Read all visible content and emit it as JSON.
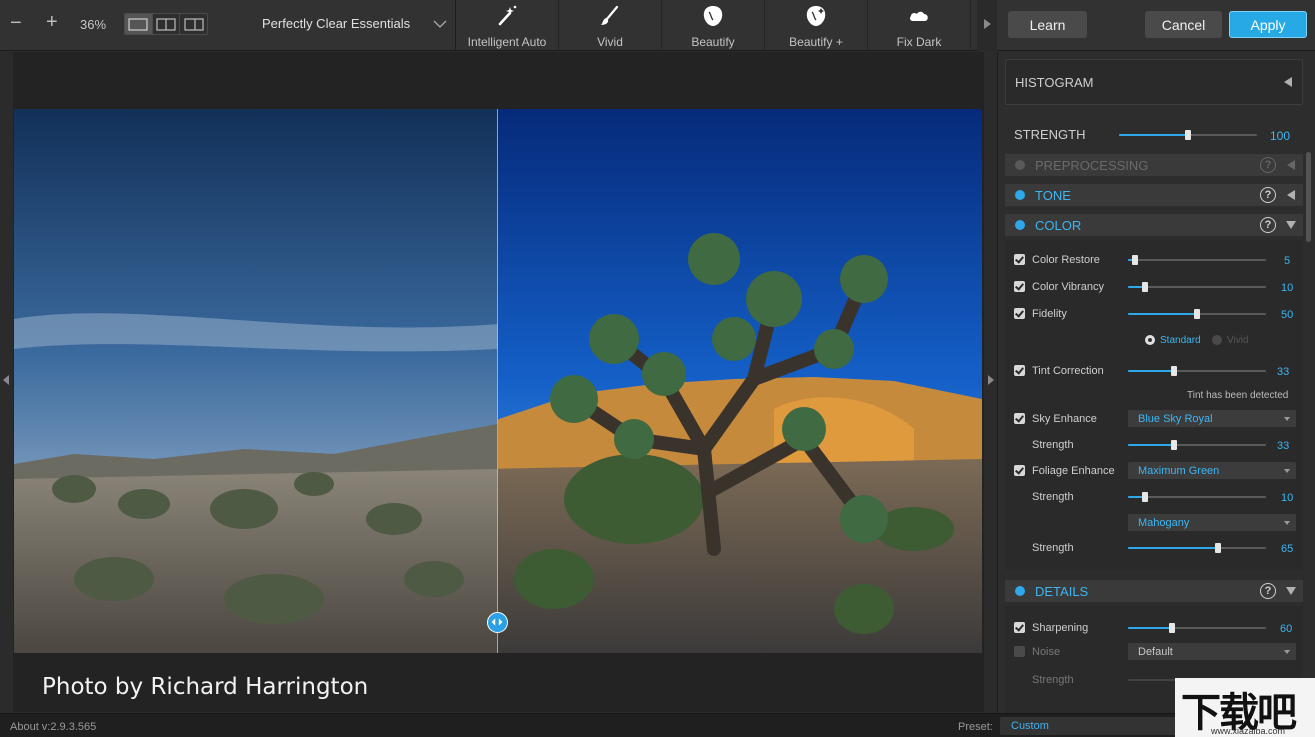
{
  "toolbar": {
    "zoom_out": "−",
    "zoom_in": "+",
    "zoom_value": "36%",
    "preset_name": "Perfectly Clear Essentials",
    "fx_buttons": [
      {
        "label": "Intelligent Auto",
        "icon": "magic-wand-icon"
      },
      {
        "label": "Vivid",
        "icon": "brush-icon"
      },
      {
        "label": "Beautify",
        "icon": "face-icon"
      },
      {
        "label": "Beautify +",
        "icon": "face-plus-icon"
      },
      {
        "label": "Fix Dark",
        "icon": "cloud-icon"
      }
    ],
    "learn": "Learn",
    "cancel": "Cancel",
    "apply": "Apply"
  },
  "image": {
    "credit": "Photo by Richard Harrington"
  },
  "status": {
    "version": "About v:2.9.3.565",
    "preset_label": "Preset:",
    "preset_value": "Custom"
  },
  "panel": {
    "histogram": "HISTOGRAM",
    "strength_label": "STRENGTH",
    "strength_value": "100",
    "strength_fraction": 0.5,
    "sections": {
      "preprocessing": "PREPROCESSING",
      "tone": "TONE",
      "color": "COLOR",
      "details": "DETAILS"
    },
    "help": "?",
    "color": {
      "color_restore": {
        "label": "Color Restore",
        "value": "5",
        "fraction": 0.05
      },
      "color_vibrancy": {
        "label": "Color Vibrancy",
        "value": "10",
        "fraction": 0.12
      },
      "fidelity": {
        "label": "Fidelity",
        "value": "50",
        "fraction": 0.5
      },
      "fidelity_mode_standard": "Standard",
      "fidelity_mode_vivid": "Vivid",
      "tint_correction": {
        "label": "Tint Correction",
        "value": "33",
        "fraction": 0.33
      },
      "tint_note": "Tint has been detected",
      "sky_enhance": {
        "label": "Sky Enhance",
        "dropdown": "Blue Sky Royal"
      },
      "sky_strength": {
        "label": "Strength",
        "value": "33",
        "fraction": 0.33
      },
      "foliage_enhance": {
        "label": "Foliage Enhance",
        "dropdown": "Maximum Green"
      },
      "foliage_strength": {
        "label": "Strength",
        "value": "10",
        "fraction": 0.12
      },
      "foliage_dropdown2": "Mahogany",
      "foliage_strength2": {
        "label": "Strength",
        "value": "65",
        "fraction": 0.65
      }
    },
    "details": {
      "sharpening": {
        "label": "Sharpening",
        "value": "60",
        "fraction": 0.32
      },
      "noise": {
        "label": "Noise",
        "dropdown": "Default"
      },
      "noise_strength": {
        "label": "Strength"
      }
    }
  },
  "watermark": {
    "main": "下载吧",
    "url": "www.xiazaiba.com"
  },
  "colors": {
    "accent": "#2ea8e8",
    "apply": "#27a9e6"
  }
}
